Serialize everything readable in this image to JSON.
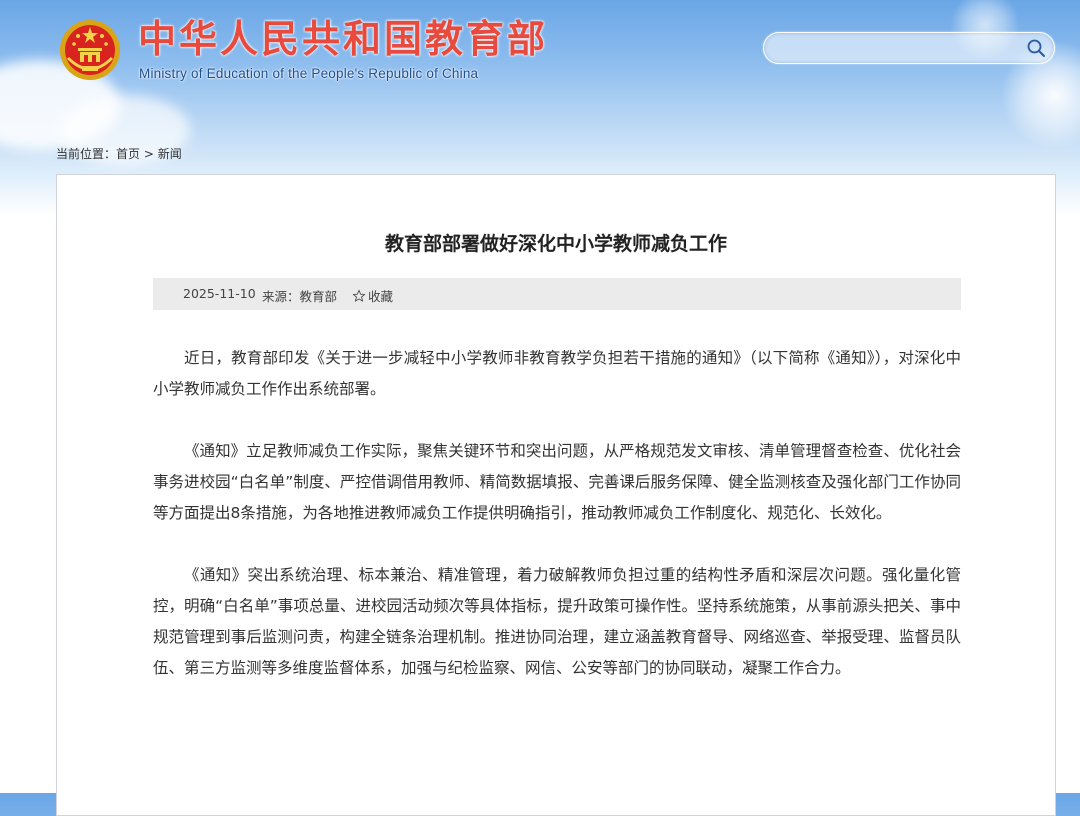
{
  "header": {
    "title_cn": "中华人民共和国教育部",
    "title_en": "Ministry of Education of the People's Republic of China",
    "search_placeholder": ""
  },
  "breadcrumb": {
    "prefix": "当前位置：",
    "home": "首页",
    "separator": " > ",
    "current": "新闻"
  },
  "article": {
    "title": "教育部部署做好深化中小学教师减负工作",
    "date": "2025-11-10",
    "source": "来源：教育部",
    "favorite_label": "收藏",
    "paragraphs": [
      "近日，教育部印发《关于进一步减轻中小学教师非教育教学负担若干措施的通知》（以下简称《通知》），对深化中小学教师减负工作作出系统部署。",
      "《通知》立足教师减负工作实际，聚焦关键环节和突出问题，从严格规范发文审核、清单管理督查检查、优化社会事务进校园“白名单”制度、严控借调借用教师、精简数据填报、完善课后服务保障、健全监测核查及强化部门工作协同等方面提出8条措施，为各地推进教师减负工作提供明确指引，推动教师减负工作制度化、规范化、长效化。",
      "《通知》突出系统治理、标本兼治、精准管理，着力破解教师负担过重的结构性矛盾和深层次问题。强化量化管控，明确“白名单”事项总量、进校园活动频次等具体指标，提升政策可操作性。坚持系统施策，从事前源头把关、事中规范管理到事后监测问责，构建全链条治理机制。推进协同治理，建立涵盖教育督导、网络巡查、举报受理、监督员队伍、第三方监测等多维度监督体系，加强与纪检监察、网信、公安等部门的协同联动，凝聚工作合力。"
    ]
  },
  "colors": {
    "title_red": "#e84a3e",
    "subtitle_blue": "#1f4f93",
    "meta_bg": "#ebebeb"
  }
}
